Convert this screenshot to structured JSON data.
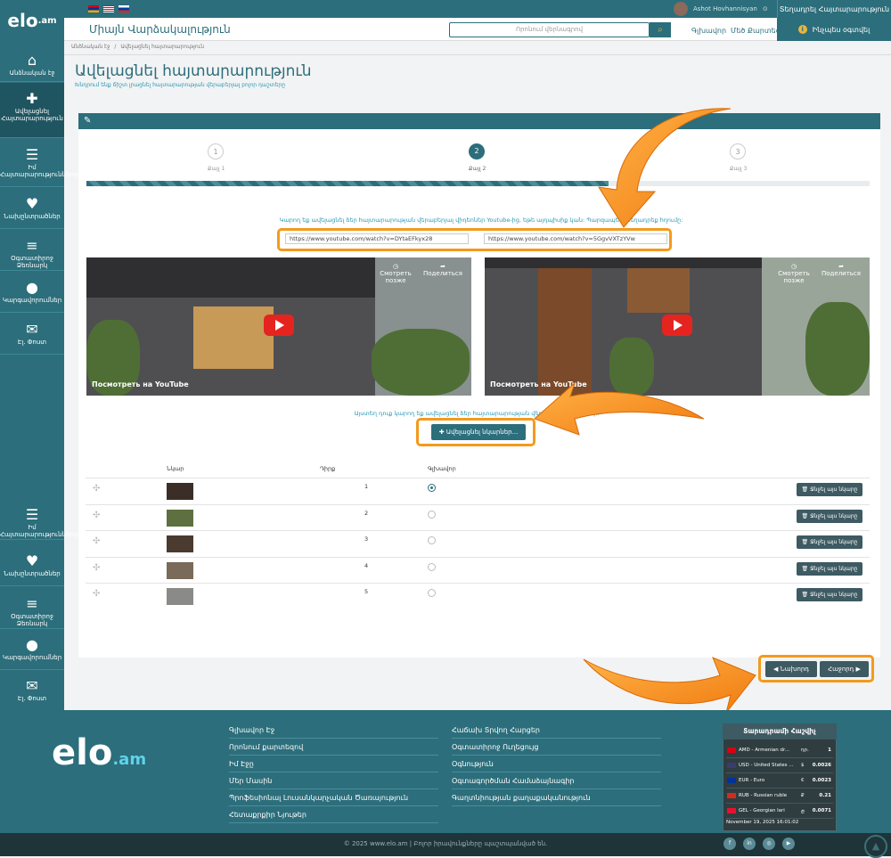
{
  "topbar": {
    "user_name": "Ashot Hovhannisyan",
    "post_ad": "Տեղադրել Հայտարարություն"
  },
  "header": {
    "logo": "elo",
    "logo_suffix": ".am",
    "tagline": "Միայն Վարձակալություն",
    "search_placeholder": "Որոնում վերնագրով",
    "nav_home": "Գլխավոր",
    "nav_map": "Մեծ Քարտեզ",
    "howto": "Ինչպես օգտվել"
  },
  "sidebar": {
    "items": [
      {
        "label": "Անձնական էջ",
        "icon": "home-icon"
      },
      {
        "label": "Ավելացնել Հայտարարություն",
        "icon": "plus-square-icon"
      },
      {
        "label": "Իմ Հայտարարությունները",
        "icon": "list-icon"
      },
      {
        "label": "Նախընտրածներ",
        "icon": "heart-icon"
      },
      {
        "label": "Օգտատիրոջ Ձեռնարկ",
        "icon": "sliders-icon"
      },
      {
        "label": "Կարգավորումներ",
        "icon": "user-icon"
      },
      {
        "label": "Էլ. Փոստ",
        "icon": "envelope-icon"
      }
    ],
    "items_bottom": [
      {
        "label": "Իմ Հայտարարությունները",
        "icon": "list-icon"
      },
      {
        "label": "Նախընտրածներ",
        "icon": "heart-icon"
      },
      {
        "label": "Օգտատիրոջ Ձեռնարկ",
        "icon": "sliders-icon"
      },
      {
        "label": "Կարգավորումներ",
        "icon": "user-icon"
      },
      {
        "label": "Էլ. Փոստ",
        "icon": "envelope-icon"
      }
    ]
  },
  "breadcrumb": {
    "home": "Անձնական էջ",
    "sep": "/",
    "current": "Ավելացնել հայտարարություն"
  },
  "page": {
    "title": "Ավելացնել հայտարարություն",
    "subtitle": "Խնդրում ենք ճիշտ լրացնել հայտարարության վերաբերյալ բոլոր դաշտերը"
  },
  "steps": [
    {
      "num": "1",
      "label": "Քայլ 1"
    },
    {
      "num": "2",
      "label": "Քայլ 2"
    },
    {
      "num": "3",
      "label": "Քայլ 3"
    }
  ],
  "progress_percent": 67,
  "video": {
    "hint": "Կարող եք ավելացնել ձեր հայտարարության վերաբերյալ վիդեոներ Youtube-ից, եթե այդպիսիք կան: Պարզապես տեղադրեք հղումը:",
    "url1": "https://www.youtube.com/watch?v=DYtaEFkyx28",
    "url2": "https://www.youtube.com/watch?v=5GgvVXTzYVw",
    "watch_later": "Смотреть позже",
    "share": "Поделиться",
    "watch_on": "Посмотреть на",
    "youtube": "YouTube"
  },
  "images": {
    "hint": "Այստեղ դուք կարող եք ավելացնել ձեր հայտարարության վերաբերյալ նկարներ:",
    "add_button": "Ավելացնել նկարներ...",
    "col_image": "Նկար",
    "col_position": "Դիրք",
    "col_main": "Գլխավոր",
    "delete_label": "Ջնջել այս նկարը",
    "rows": [
      {
        "position": "1",
        "main": true
      },
      {
        "position": "2",
        "main": false
      },
      {
        "position": "3",
        "main": false
      },
      {
        "position": "4",
        "main": false
      },
      {
        "position": "5",
        "main": false
      }
    ]
  },
  "nav": {
    "prev": "Նախորդ",
    "next": "Հաջորդ"
  },
  "footer": {
    "links_col1": [
      "Գլխավոր Էջ",
      "Որոնում քարտեզով",
      "Իմ Էջը",
      "Մեր Մասին",
      "Պրոֆեսիոնալ Լուսանկարչական Ծառայություն",
      "Հետաքրքիր Նյութեր"
    ],
    "links_col2": [
      "Հաճախ Տրվող Հարցեր",
      "Օգտատիրոջ Ուղեցույց",
      "Օգնություն",
      "Օգտագործման Համաձայնագիր",
      "Գաղտնիության քաղաքականություն"
    ],
    "currency_title": "Տարադրամի Հաշվիչ",
    "currencies": [
      {
        "name": "AMD - Armenian dr...",
        "symbol": "դր.",
        "value": "1"
      },
      {
        "name": "USD - United States ...",
        "symbol": "$",
        "value": "0.0026"
      },
      {
        "name": "EUR - Euro",
        "symbol": "€",
        "value": "0.0023"
      },
      {
        "name": "RUB - Russian ruble",
        "symbol": "₽",
        "value": "0.21"
      },
      {
        "name": "GEL - Georgian lari",
        "symbol": "₾",
        "value": "0.0071"
      }
    ],
    "currency_date": "November 19, 2025 16:01:02",
    "copyright": "© 2025 www.elo.am | Բոլոր իրավունքները պաշտպանված են."
  },
  "colors": {
    "primary": "#2c6e7b",
    "accent": "#f39a1d",
    "link": "#2a96b4",
    "warning": "#e9b53c"
  }
}
